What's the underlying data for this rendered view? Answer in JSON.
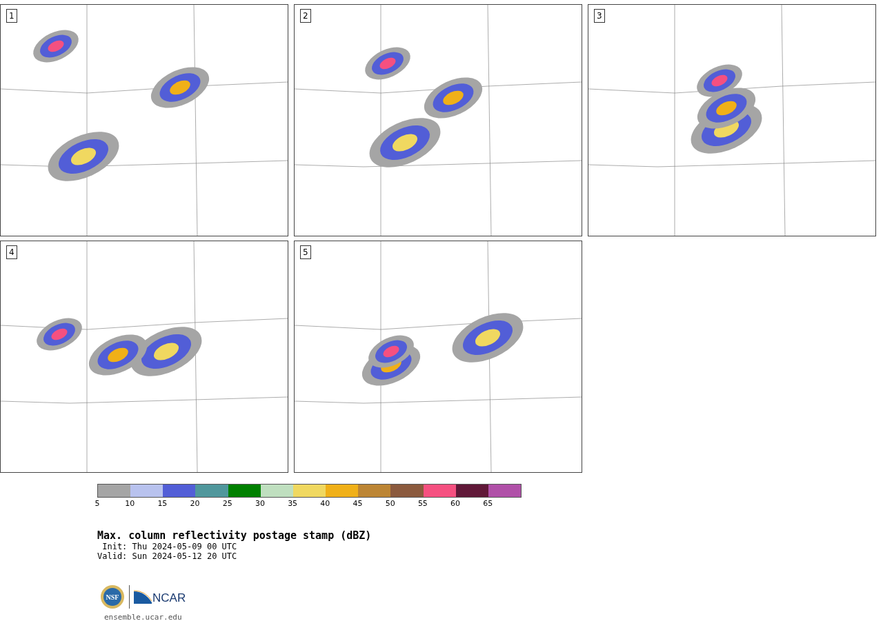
{
  "panels": [
    {
      "label": "1"
    },
    {
      "label": "2"
    },
    {
      "label": "3"
    },
    {
      "label": "4"
    },
    {
      "label": "5"
    }
  ],
  "colorbar": {
    "segments": [
      {
        "color": "#a5a5a5"
      },
      {
        "color": "#b8c2ee"
      },
      {
        "color": "#525ed7"
      },
      {
        "color": "#50979c"
      },
      {
        "color": "#008000"
      },
      {
        "color": "#bfdfbf"
      },
      {
        "color": "#f0d860"
      },
      {
        "color": "#f0b018"
      },
      {
        "color": "#bc8534"
      },
      {
        "color": "#8b5a3e"
      },
      {
        "color": "#f55080"
      },
      {
        "color": "#601838"
      },
      {
        "color": "#b050a8"
      }
    ],
    "ticks": [
      "5",
      "10",
      "15",
      "20",
      "25",
      "30",
      "35",
      "40",
      "45",
      "50",
      "55",
      "60",
      "65"
    ]
  },
  "title": "Max. column reflectivity postage stamp (dBZ)",
  "init": " Init: Thu 2024-05-09 00 UTC",
  "valid": "Valid: Sun 2024-05-12 20 UTC",
  "logos": {
    "nsf": "NSF",
    "ncar": "NCAR"
  },
  "footer": "ensemble.ucar.edu"
}
